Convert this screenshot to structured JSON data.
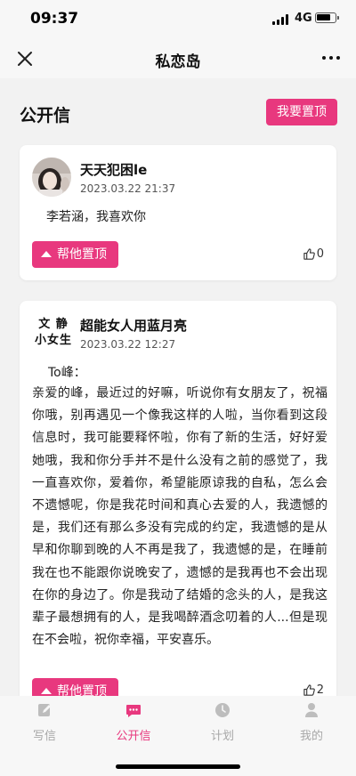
{
  "status_bar": {
    "time": "09:37",
    "network": "4G",
    "battery_level": 0.8
  },
  "nav": {
    "title": "私恋岛",
    "close_icon": "close-icon",
    "more_icon": "more-icon"
  },
  "section": {
    "title": "公开信",
    "top_button_label": "我要置顶"
  },
  "posts": [
    {
      "avatar_kind": "photo",
      "username": "天天犯困le",
      "date": "2023.03.22 21:37",
      "message": "李若涵，我喜欢你",
      "help_label": "帮他置顶",
      "likes": "0"
    },
    {
      "avatar_kind": "text",
      "avatar_text_line1": "文 静",
      "avatar_text_line2": "小女生",
      "username": "超能女人用蓝月亮",
      "date": "2023.03.22 12:27",
      "greeting": "To峰：",
      "message": "亲爱的峰，最近过的好嘛，听说你有女朋友了，祝福你哦，别再遇见一个像我这样的人啦，当你看到这段信息时，我可能要释怀啦，你有了新的生活，好好爱她哦，我和你分手并不是什么没有之前的感觉了，我一直喜欢你，爱着你，希望能原谅我的自私，怎么会不遗憾呢，你是我花时间和真心去爱的人，我遗憾的是，我们还有那么多没有完成的约定，我遗憾的是从早和你聊到晚的人不再是我了，我遗憾的是，在睡前我在也不能跟你说晚安了，遗憾的是我再也不会出现在你的身边了。你是我动了结婚的念头的人，是我这辈子最想拥有的人，是我喝醉酒念叨着的人...但是现在不会啦，祝你幸福，平安喜乐。",
      "help_label": "帮他置顶",
      "likes": "2"
    }
  ],
  "tabs": [
    {
      "label": "写信",
      "icon": "pencil-icon",
      "active": false
    },
    {
      "label": "公开信",
      "icon": "chat-bubble-icon",
      "active": true
    },
    {
      "label": "计划",
      "icon": "clock-icon",
      "active": false
    },
    {
      "label": "我的",
      "icon": "person-icon",
      "active": false
    }
  ],
  "colors": {
    "accent": "#e8387e",
    "inactive": "#a8a8a8"
  }
}
